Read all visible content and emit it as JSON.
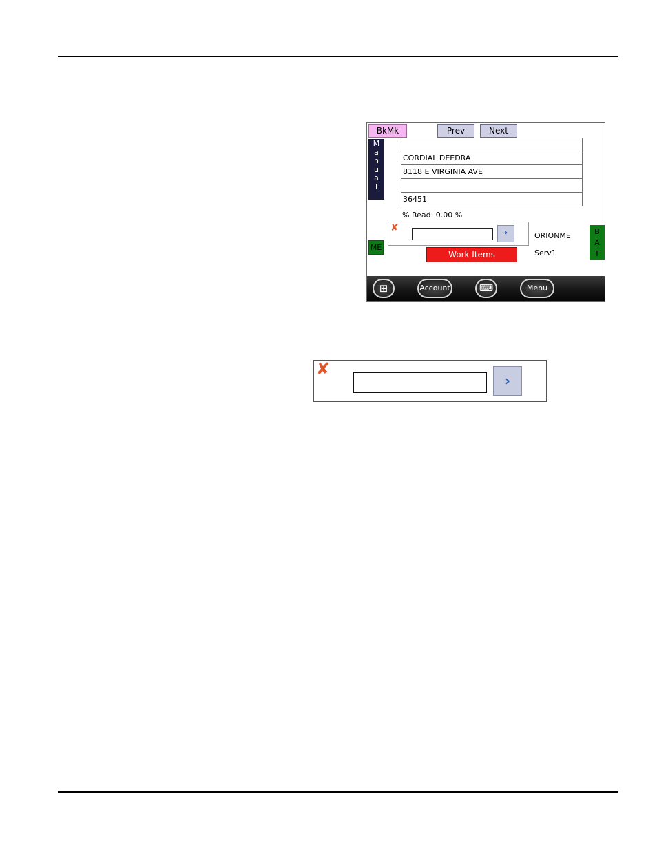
{
  "device": {
    "top_buttons": {
      "bookmark": "BkMk",
      "prev": "Prev",
      "next": "Next"
    },
    "manual_letters": [
      "M",
      "a",
      "n",
      "u",
      "a",
      "l"
    ],
    "fields": [
      "",
      "CORDIAL DEEDRA",
      "8118 E VIRGINIA AVE",
      "",
      "36451"
    ],
    "percent_read": "% Read: 0.00 %",
    "entry": {
      "input_value": "",
      "clear_icon": "red-x-icon",
      "go_icon": "chevron-right-icon",
      "go_symbol": "›",
      "clear_symbol": "✘"
    },
    "me_label": "ME",
    "bat_letters": [
      "B",
      "A",
      "T"
    ],
    "work_items_label": "Work Items",
    "meter_reader": "ORIONME",
    "server": "Serv1",
    "taskbar": {
      "start_icon": "windows-start-icon",
      "start_symbol": "⊞",
      "account_label": "Account",
      "keyboard_icon": "keyboard-icon",
      "keyboard_symbol": "⌨",
      "menu_label": "Menu"
    },
    "colors": {
      "bookmark": "#f6b6f2",
      "manual": "#1b1b3e",
      "status_green": "#0d7a16",
      "work_items": "#ee1b1b"
    }
  },
  "zoomed_entry": {
    "input_value": "",
    "clear_symbol": "✘",
    "go_symbol": "›"
  }
}
